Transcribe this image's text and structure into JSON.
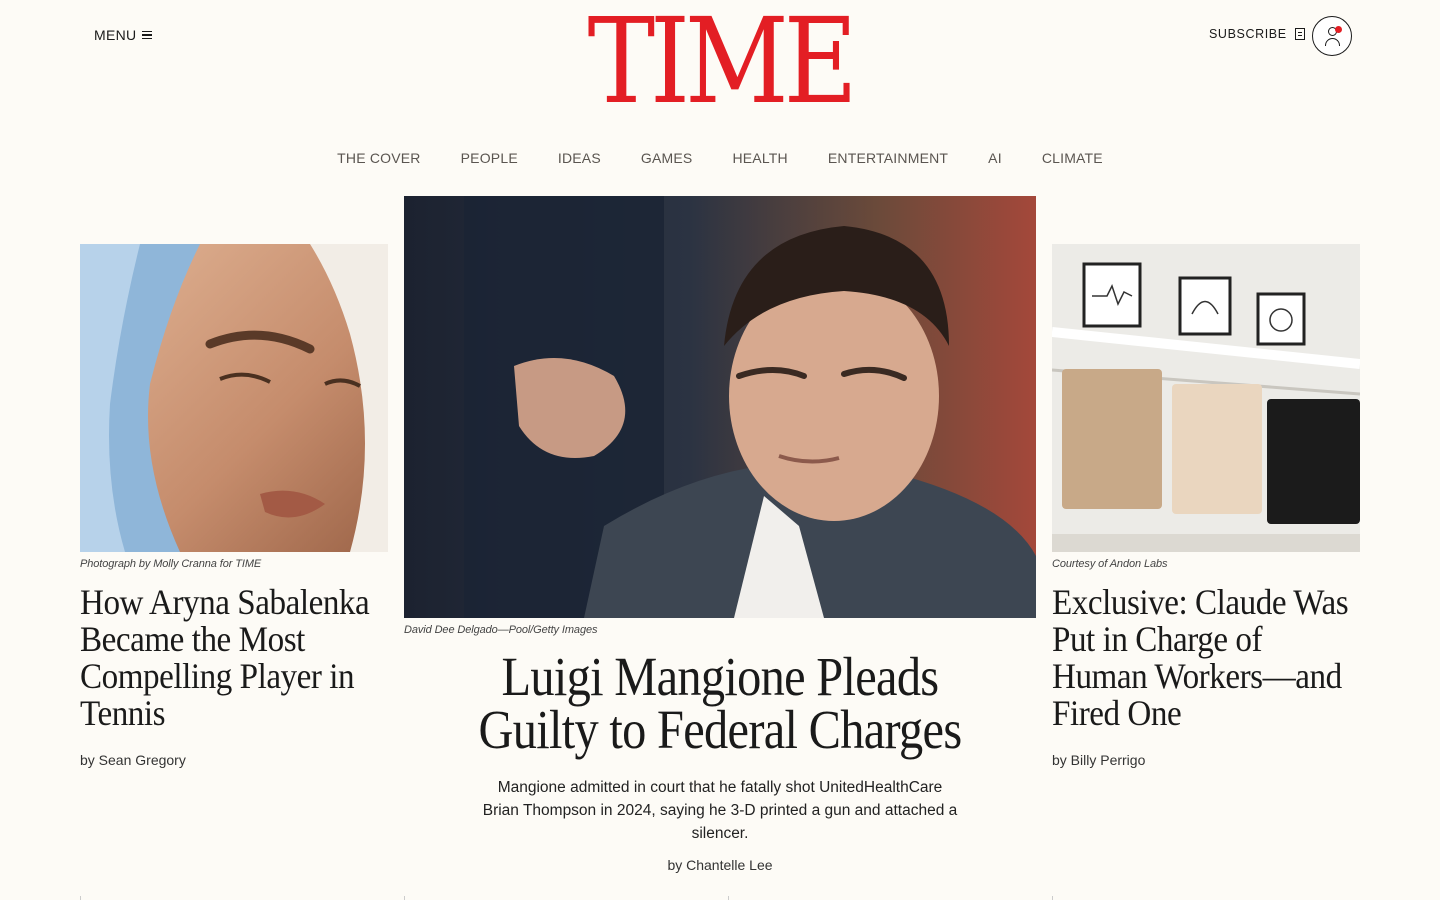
{
  "header": {
    "menu_label": "MENU",
    "logo": "TIME",
    "subscribe_label": "SUBSCRIBE",
    "accent_color": "#e31e24"
  },
  "nav": {
    "items": [
      "THE COVER",
      "PEOPLE",
      "IDEAS",
      "GAMES",
      "HEALTH",
      "ENTERTAINMENT",
      "AI",
      "CLIMATE"
    ]
  },
  "stories": {
    "left": {
      "credit": "Photograph by Molly Cranna for TIME",
      "title": "How Aryna Sabalenka Became the Most Compelling Player in Tennis",
      "byline": "by Sean Gregory"
    },
    "main": {
      "credit": "David Dee Delgado—Pool/Getty Images",
      "title": "Luigi Mangione Pleads Guilty to Federal Charges",
      "dek": "Mangione admitted in court that he fatally shot UnitedHealthCare Brian Thompson in 2024, saying he 3-D printed a gun and attached a silencer.",
      "byline": "by Chantelle Lee"
    },
    "right": {
      "credit": "Courtesy of Andon Labs",
      "title": "Exclusive: Claude Was Put in Charge of Human Workers—and Fired One",
      "byline": "by Billy Perrigo"
    }
  }
}
